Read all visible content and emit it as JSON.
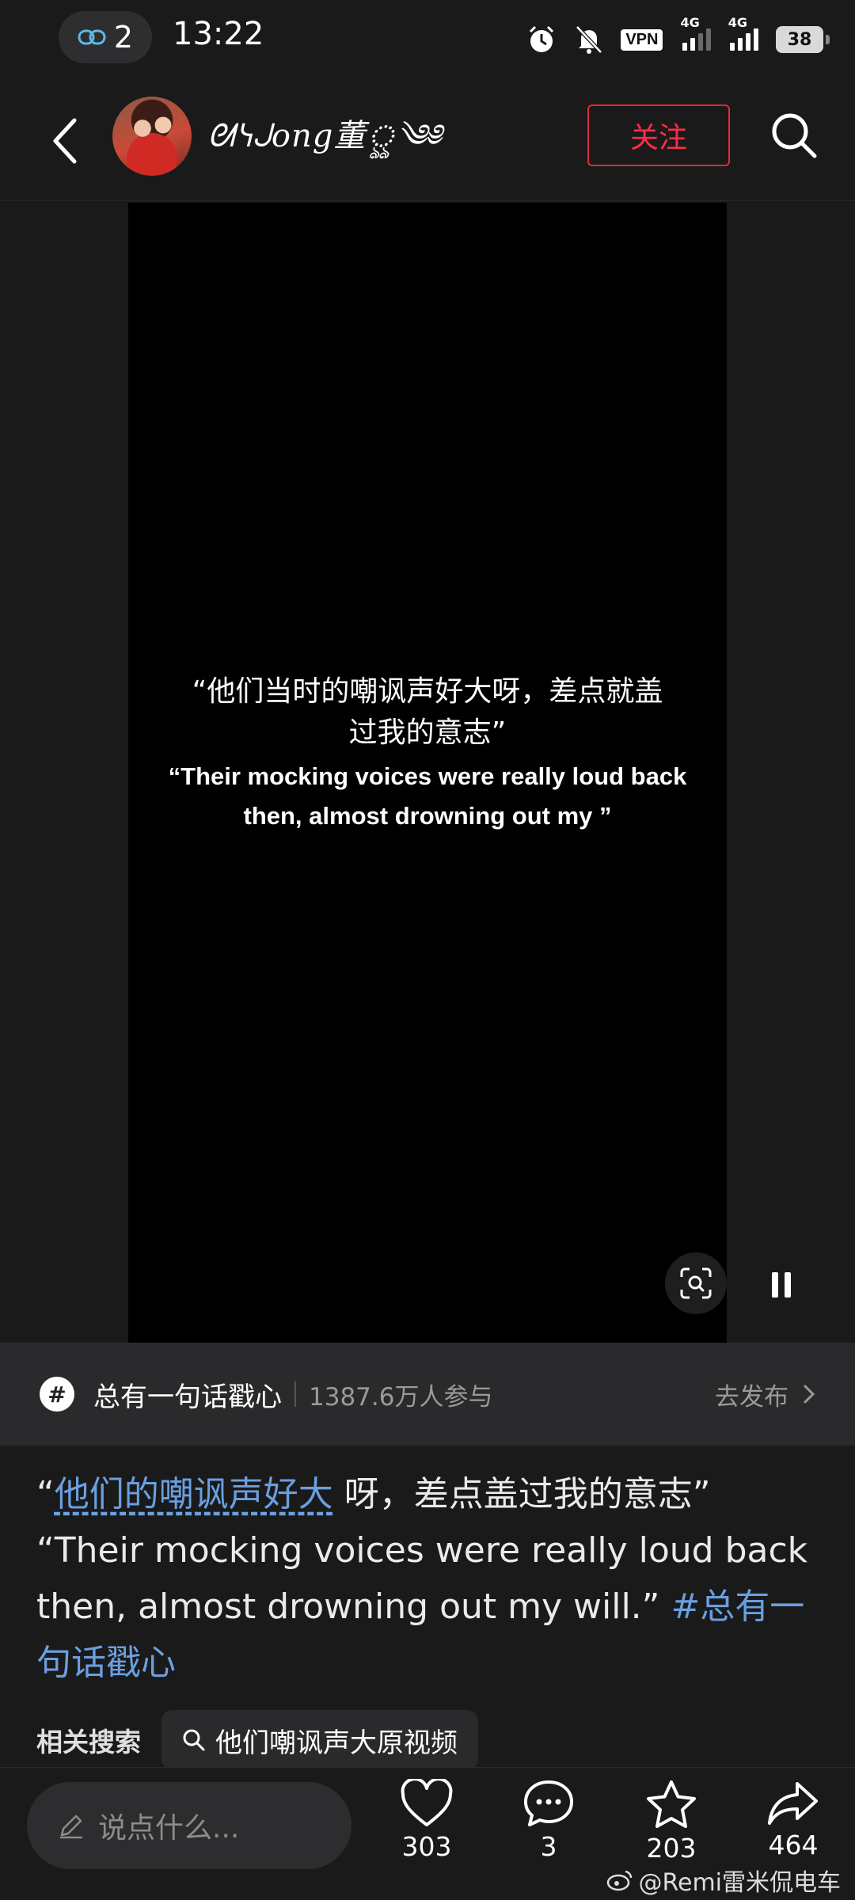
{
  "status_bar": {
    "link_count": "2",
    "time": "13:22",
    "vpn": "VPN",
    "signal1_label": "4G",
    "signal2_label": "4G",
    "battery": "38"
  },
  "header": {
    "username": "ᘛᓭᒍong董ৣ༄༅",
    "follow_label": "关注"
  },
  "video": {
    "subtitle_cn": "“他们当时的嘲讽声好大呀，差点就盖过我的意志”",
    "subtitle_en": "“Their mocking voices were really loud back then, almost drowning out my ”"
  },
  "topic": {
    "icon": "#",
    "name": "总有一句话戳心",
    "participants": "1387.6万人参与",
    "publish_label": "去发布"
  },
  "post": {
    "quote_open": "“",
    "highlight": "他们的嘲讽声好大",
    "text_cn_rest": " 呀，差点盖过我的意志”",
    "text_en": "“Their mocking voices were really loud back then, almost drowning out my will.” ",
    "hashtag": "#总有一句话戳心"
  },
  "related": {
    "label": "相关搜索",
    "query": "他们嘲讽声大原视频"
  },
  "bottom_bar": {
    "comment_placeholder": "说点什么...",
    "likes": "303",
    "comments": "3",
    "favorites": "203",
    "shares": "464",
    "watermark": "@Remi雷米侃电车"
  },
  "colors": {
    "background": "#1a1a1a",
    "accent_red": "#ff2d47",
    "link_blue": "#6a9fe0"
  }
}
